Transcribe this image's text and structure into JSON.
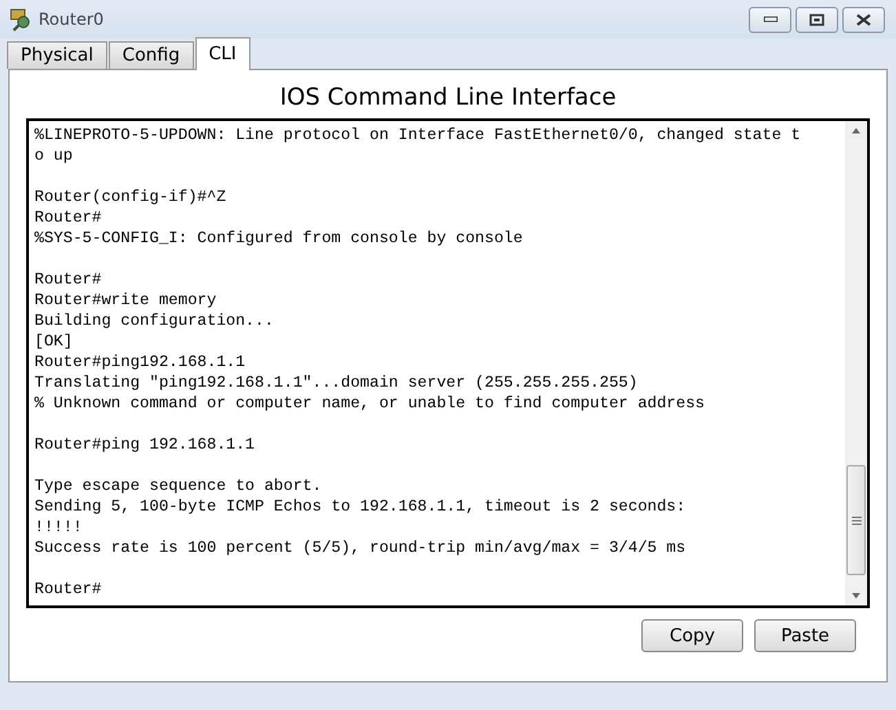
{
  "window": {
    "title": "Router0"
  },
  "tabs": [
    {
      "label": "Physical",
      "selected": false
    },
    {
      "label": "Config",
      "selected": false
    },
    {
      "label": "CLI",
      "selected": true
    }
  ],
  "heading": "IOS Command Line Interface",
  "console_blocks": [
    {
      "lines": [
        "%LINEPROTO-5-UPDOWN: Line protocol on Interface FastEthernet0/0, changed state t",
        "o up"
      ]
    },
    {
      "lines": [
        "Router(config-if)#^Z",
        "Router#",
        "%SYS-5-CONFIG_I: Configured from console by console"
      ]
    },
    {
      "lines": [
        "Router#",
        "Router#write memory",
        "Building configuration...",
        "[OK]",
        "Router#ping192.168.1.1",
        "Translating \"ping192.168.1.1\"...domain server (255.255.255.255)",
        "% Unknown command or computer name, or unable to find computer address"
      ]
    },
    {
      "lines": [
        "Router#ping 192.168.1.1"
      ]
    },
    {
      "lines": [
        "Type escape sequence to abort.",
        "Sending 5, 100-byte ICMP Echos to 192.168.1.1, timeout is 2 seconds:",
        "!!!!!",
        "Success rate is 100 percent (5/5), round-trip min/avg/max = 3/4/5 ms"
      ]
    },
    {
      "lines": [
        "Router#"
      ]
    }
  ],
  "buttons": [
    {
      "label": "Copy"
    },
    {
      "label": "Paste"
    }
  ]
}
